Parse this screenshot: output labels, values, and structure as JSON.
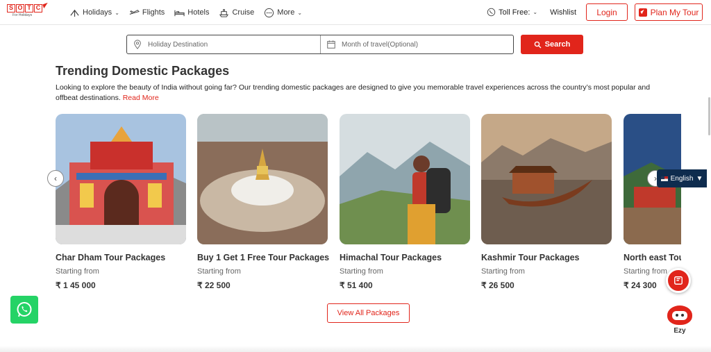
{
  "header": {
    "logo_text": [
      "S",
      "O",
      "T",
      "C"
    ],
    "logo_sub": "For Holidays",
    "nav": [
      {
        "label": "Holidays",
        "icon": "holidays-icon",
        "dropdown": true
      },
      {
        "label": "Flights",
        "icon": "plane-icon",
        "dropdown": false
      },
      {
        "label": "Hotels",
        "icon": "bed-icon",
        "dropdown": false
      },
      {
        "label": "Cruise",
        "icon": "cruise-icon",
        "dropdown": false
      },
      {
        "label": "More",
        "icon": "more-icon",
        "dropdown": true
      }
    ],
    "toll_free": "Toll Free:",
    "wishlist": "Wishlist",
    "login": "Login",
    "plan": "Plan My Tour"
  },
  "search": {
    "destination_placeholder": "Holiday Destination",
    "month_placeholder": "Month of travel(Optional)",
    "button": "Search"
  },
  "section": {
    "title": "Trending Domestic Packages",
    "description": "Looking to explore the beauty of India without going far? Our trending domestic packages are designed to give you memorable travel experiences across the country’s most popular and offbeat destinations.",
    "read_more": "Read More"
  },
  "cards": [
    {
      "title": "Char Dham Tour Packages",
      "from": "Starting from",
      "price": "₹ 1 45 000"
    },
    {
      "title": "Buy 1 Get 1 Free Tour Packages",
      "from": "Starting from",
      "price": "₹ 22 500"
    },
    {
      "title": "Himachal Tour Packages",
      "from": "Starting from",
      "price": "₹ 51 400"
    },
    {
      "title": "Kashmir Tour Packages",
      "from": "Starting from",
      "price": "₹ 26 500"
    },
    {
      "title": "North east Tour Packages",
      "from": "Starting from",
      "price": "₹ 24 300"
    }
  ],
  "view_all": "View All Packages",
  "language": "English",
  "ezy": "Ezy",
  "colors": {
    "brand": "#e1251b",
    "lang_bg": "#0e2c4e",
    "whatsapp": "#25d366"
  }
}
